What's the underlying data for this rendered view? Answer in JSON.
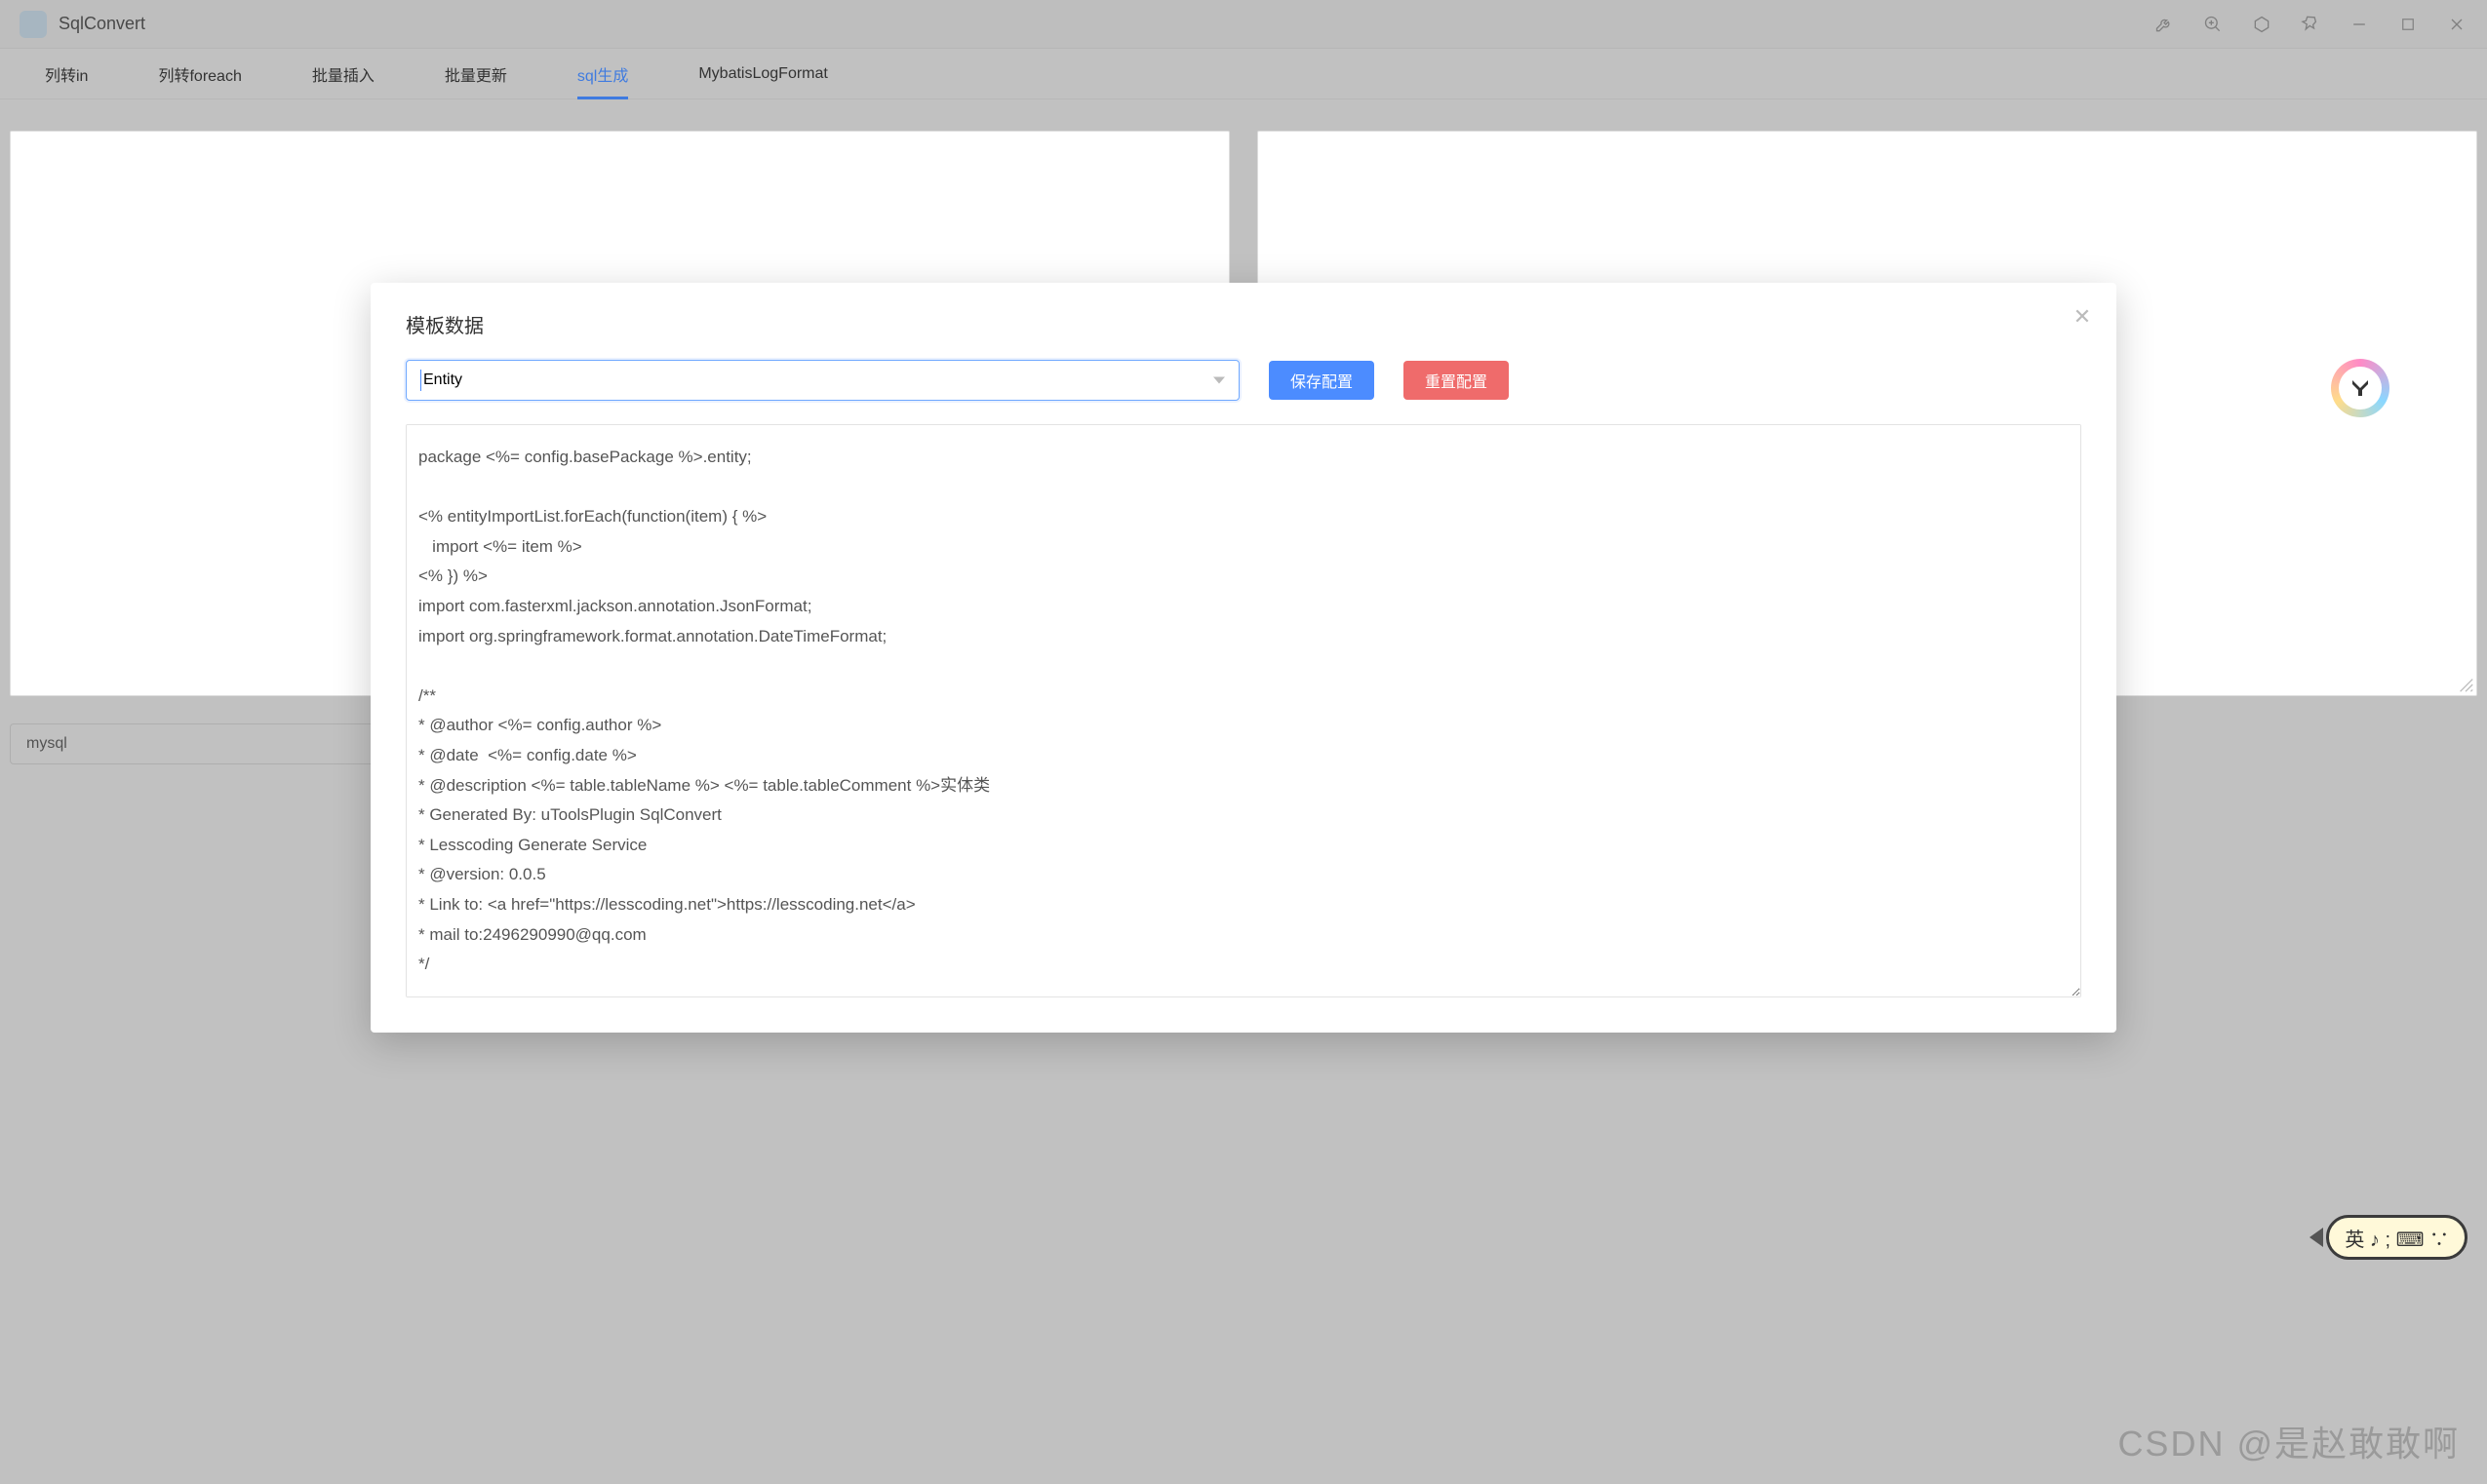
{
  "app": {
    "title": "SqlConvert"
  },
  "titlebarIcons": {
    "wrench": "wrench-icon",
    "zoom": "zoom-icon",
    "hex": "hex-icon",
    "pin": "pin-icon",
    "min": "minimize-icon",
    "max": "maximize-icon",
    "close": "close-icon"
  },
  "tabs": {
    "items": [
      {
        "label": "列转in"
      },
      {
        "label": "列转foreach"
      },
      {
        "label": "批量插入"
      },
      {
        "label": "批量更新"
      },
      {
        "label": "sql生成",
        "active": true
      },
      {
        "label": "MybatisLogFormat"
      }
    ]
  },
  "mainSelect": {
    "value": "mysql"
  },
  "modal": {
    "title": "模板数据",
    "entitySelect": {
      "value": "Entity"
    },
    "saveButton": "保存配置",
    "resetButton": "重置配置",
    "codeContent": "package <%= config.basePackage %>.entity;\n\n<% entityImportList.forEach(function(item) { %>\n   import <%= item %>\n<% }) %>\nimport com.fasterxml.jackson.annotation.JsonFormat;\nimport org.springframework.format.annotation.DateTimeFormat;\n\n/**\n* @author <%= config.author %>\n* @date  <%= config.date %>\n* @description <%= table.tableName %> <%= table.tableComment %>实体类\n* Generated By: uToolsPlugin SqlConvert\n* Lesscoding Generate Service\n* @version: 0.0.5\n* Link to: <a href=\"https://lesscoding.net\">https://lesscoding.net</a>\n* mail to:2496290990@qq.com\n*/"
  },
  "imeBar": {
    "text": "英 ♪ ; ⌨ ∵"
  },
  "watermark": {
    "text": "CSDN @是赵敢敢啊"
  }
}
